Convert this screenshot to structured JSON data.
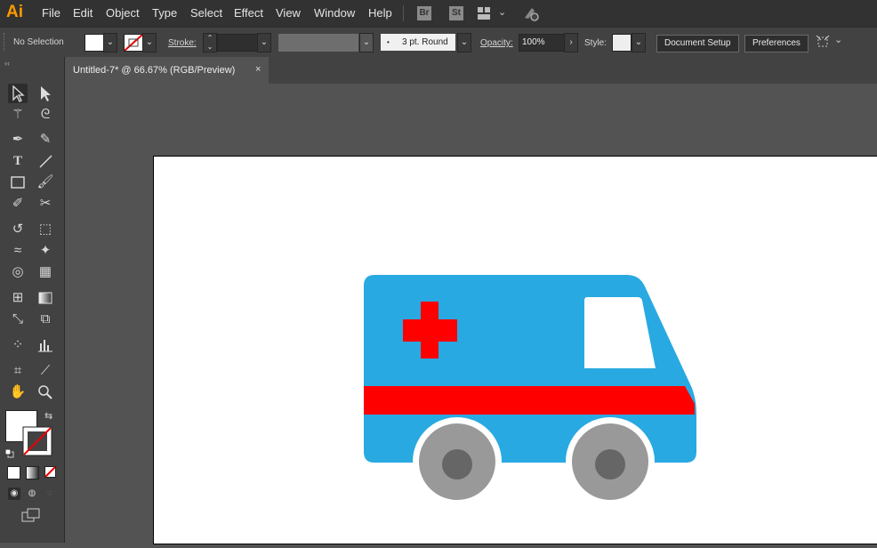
{
  "app": {
    "logo": "Ai"
  },
  "menu": [
    "File",
    "Edit",
    "Object",
    "Type",
    "Select",
    "Effect",
    "View",
    "Window",
    "Help"
  ],
  "app_buttons": {
    "bridge": "Br",
    "stock": "St"
  },
  "control_bar": {
    "selection_status": "No Selection",
    "stroke_label": "Stroke:",
    "brush_label": "3 pt. Round",
    "opacity_label": "Opacity:",
    "opacity_value": "100%",
    "style_label": "Style:",
    "document_setup": "Document Setup",
    "preferences": "Preferences"
  },
  "document": {
    "tab_title": "Untitled-7* @ 66.67% (RGB/Preview)",
    "close": "×"
  },
  "artwork": {
    "subject": "ambulance",
    "colors": {
      "body": "#29a9e1",
      "stripe": "#ff0000",
      "cross": "#ff0000",
      "window": "#ffffff",
      "tire": "#999999",
      "hub": "#666666"
    }
  },
  "colors": {
    "menubar": "#323232",
    "panel": "#424242",
    "canvas": "#535353",
    "accent": "#ff9a00"
  }
}
